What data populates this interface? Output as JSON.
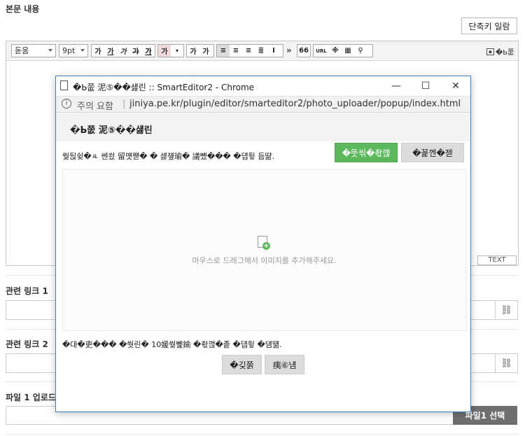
{
  "page": {
    "body_title": "본문 내용",
    "shortcut_button": "단축키 일람",
    "editor": {
      "font_select": "돋움",
      "size_select": "9pt",
      "format_buttons": [
        "가",
        "가",
        "가",
        "가",
        "가"
      ],
      "color_buttons": [
        "가",
        "가"
      ],
      "sup_buttons": [
        "가",
        "가"
      ],
      "more_label": "»",
      "quote_label": "66",
      "url_label": "URL",
      "special_char": "※",
      "photo_label": "�Ь쭚",
      "text_tab": "TEXT"
    },
    "link1_label": "관련 링크 1",
    "link2_label": "관련 링크 2",
    "file1_label": "파일 1 업로드",
    "file1_button": "파일1 선택",
    "link_icon_glyph": "🔗"
  },
  "popup": {
    "window_title": "�Ь쭚 泥⑤��섏린 :: SmartEditor2 - Chrome",
    "address": {
      "warning": "주의 요함",
      "separator": "|",
      "url": "jiniya.pe.kr/plugin/editor/smarteditor2/photo_uploader/popup/index.html"
    },
    "heading": "�Ь쭚 泥⑤��섏린",
    "instruction": "쒖뒪슂�ㅻ 쎈쑀 留먯쨷� � 섏쟾瑜� 議뼸��� �덉뒿 듬땲.",
    "select_button": "�뚯씪�좏깮",
    "delete_button": "�꾩껜�젣",
    "drop_text": "마우스로 드래그해서 이미지를 추가해주세요.",
    "footer_note": "�대�吏��� �쒓린� 10媛쒖뼱鍮 �좏깮�좉 �덉뒿 �덈떎.",
    "cancel_button": "�깆쭑",
    "confirm_button": "痍⑥냼"
  },
  "colors": {
    "accent_blue": "#3d7fc4",
    "green": "#5cb85c",
    "dark_button": "#6f6f6f"
  }
}
